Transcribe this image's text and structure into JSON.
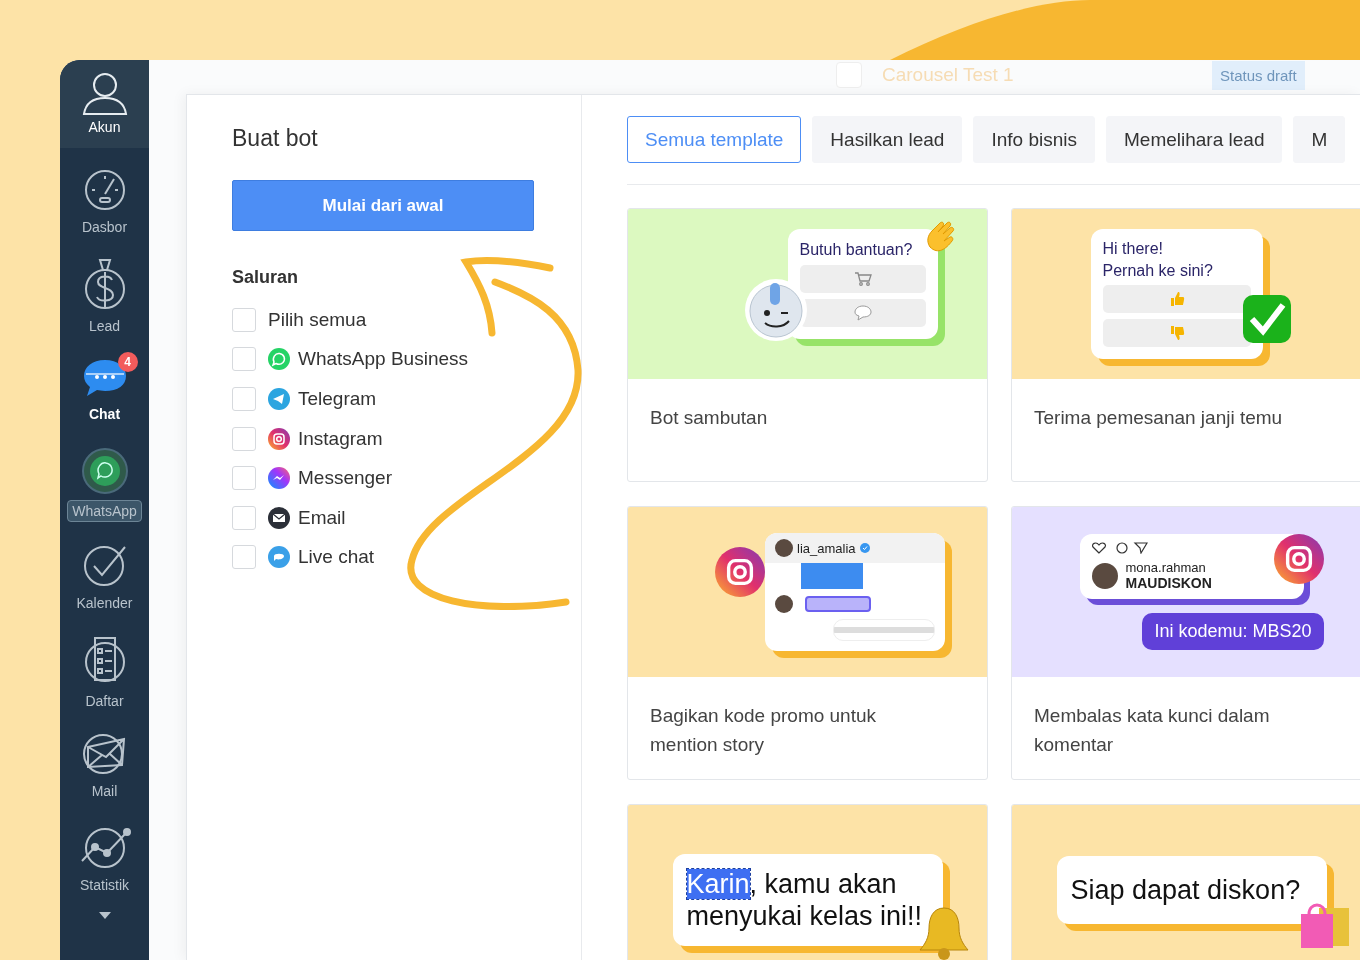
{
  "backdrop": {
    "list_item": {
      "title": "Carousel Test 1",
      "status": "Status draft",
      "checked": false
    }
  },
  "sidebar": {
    "items": [
      {
        "kind": "account",
        "label": "Akun",
        "selected": false,
        "hovered": false
      },
      {
        "kind": "dashboard",
        "label": "Dasbor",
        "selected": false,
        "hovered": false
      },
      {
        "kind": "lead",
        "label": "Lead",
        "selected": false,
        "hovered": false
      },
      {
        "kind": "chat",
        "label": "Chat",
        "selected": true,
        "hovered": false,
        "badge": "4"
      },
      {
        "kind": "whatsapp",
        "label": "WhatsApp",
        "selected": false,
        "hovered": true
      },
      {
        "kind": "calendar",
        "label": "Kalender",
        "selected": false,
        "hovered": false
      },
      {
        "kind": "list",
        "label": "Daftar",
        "selected": false,
        "hovered": false
      },
      {
        "kind": "mail",
        "label": "Mail",
        "selected": false,
        "hovered": false
      },
      {
        "kind": "stats",
        "label": "Statistik",
        "selected": false,
        "hovered": false
      }
    ]
  },
  "modal": {
    "title": "Buat bot",
    "start_button": "Mulai dari awal",
    "channels_heading": "Saluran",
    "channels": [
      {
        "kind": "all",
        "label": "Pilih semua",
        "checked": false
      },
      {
        "kind": "whatsapp",
        "label": "WhatsApp Business",
        "checked": false
      },
      {
        "kind": "telegram",
        "label": "Telegram",
        "checked": false
      },
      {
        "kind": "instagram",
        "label": "Instagram",
        "checked": false
      },
      {
        "kind": "messenger",
        "label": "Messenger",
        "checked": false
      },
      {
        "kind": "email",
        "label": "Email",
        "checked": false
      },
      {
        "kind": "livechat",
        "label": "Live chat",
        "checked": false
      }
    ],
    "tabs": [
      {
        "label": "Semua template",
        "selected": true
      },
      {
        "label": "Hasilkan lead",
        "selected": false
      },
      {
        "label": "Info bisnis",
        "selected": false
      },
      {
        "label": "Memelihara lead",
        "selected": false
      },
      {
        "label": "M",
        "selected": false
      }
    ],
    "cards": [
      {
        "kind": "welcome",
        "color": "#dcf9c0",
        "bubble": "Butuh bantuan?",
        "title": "Bot sambutan"
      },
      {
        "kind": "appointment",
        "color": "#fde3a7",
        "bubble_lines": [
          "Hi there!",
          "Pernah ke sini?"
        ],
        "title": "Terima pemesanan janji temu"
      },
      {
        "kind": "story",
        "color": "#fde3a7",
        "username": "lia_amalia",
        "title": "Bagikan kode promo untuk mention story"
      },
      {
        "kind": "comment",
        "color": "#e5e0ff",
        "username": "mona.rahman",
        "comment": "MAUDISKON",
        "reply": "Ini kodemu: MBS20",
        "title": "Membalas kata kunci dalam komentar"
      },
      {
        "kind": "personal",
        "color": "#fde3a7",
        "highlight": "Karin",
        "text": ", kamu akan menyukai kelas ini!!"
      },
      {
        "kind": "discount",
        "color": "#fde3a7",
        "bubble": "Siap dapat diskon?"
      }
    ]
  }
}
